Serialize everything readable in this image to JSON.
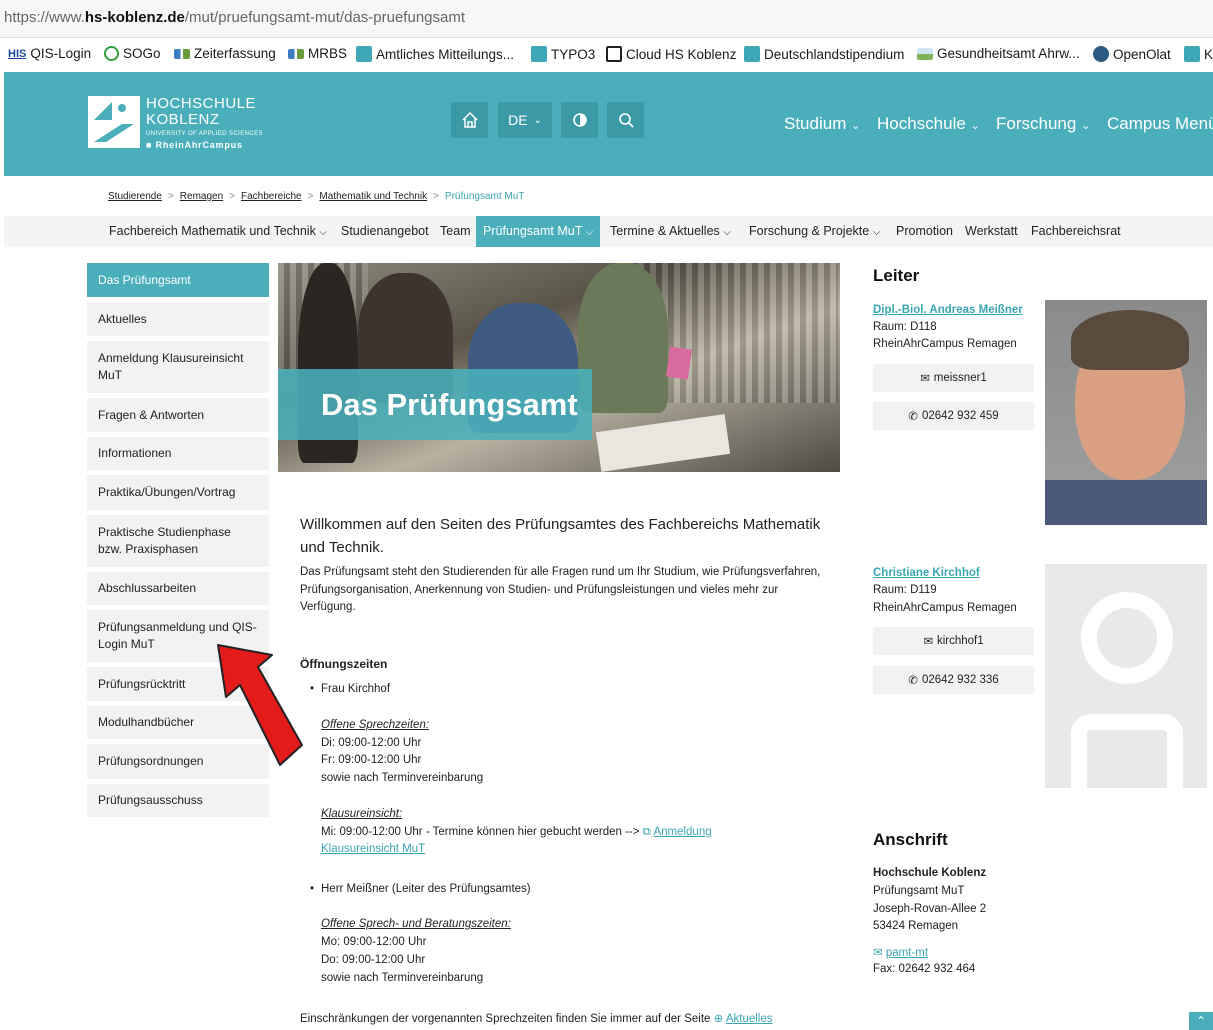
{
  "browser": {
    "url_prefix": "https://www.",
    "url_host": "hs-koblenz.de",
    "url_path": "/mut/pruefungsamt-mut/das-pruefungsamt"
  },
  "bookmarks": [
    {
      "label": "QIS-Login",
      "icon": "his-icon"
    },
    {
      "label": "SOGo",
      "icon": "sogo-icon"
    },
    {
      "label": "Zeiterfassung",
      "icon": "bar-icon"
    },
    {
      "label": "MRBS",
      "icon": "bar-icon"
    },
    {
      "label": "Amtliches Mitteilungs...",
      "icon": "hs-icon"
    },
    {
      "label": "TYPO3",
      "icon": "hs-icon"
    },
    {
      "label": "Cloud HS Koblenz",
      "icon": "folder-icon"
    },
    {
      "label": "Deutschlandstipendium",
      "icon": "hs-icon"
    },
    {
      "label": "Gesundheitsamt Ahrw...",
      "icon": "image-icon"
    },
    {
      "label": "OpenOlat",
      "icon": "openolat-icon"
    },
    {
      "label": "K",
      "icon": "hs-icon"
    }
  ],
  "logo": {
    "line1": "HOCHSCHULE",
    "line2": "KOBLENZ",
    "line3": "UNIVERSITY OF APPLIED SCIENCES",
    "line4": "RheinAhrCampus"
  },
  "header": {
    "lang": "DE",
    "nav": [
      "Studium",
      "Hochschule",
      "Forschung",
      "Campus Menü"
    ]
  },
  "breadcrumb": [
    "Studierende",
    "Remagen",
    "Fachbereiche",
    "Mathematik und Technik",
    "Prüfungsamt MuT"
  ],
  "subnav": [
    "Fachbereich Mathematik und Technik",
    "Studienangebot",
    "Team",
    "Prüfungsamt MuT",
    "Termine & Aktuelles",
    "Forschung & Projekte",
    "Promotion",
    "Werkstatt",
    "Fachbereichsrat"
  ],
  "sidebar": [
    "Das Prüfungsamt",
    "Aktuelles",
    "Anmeldung Klausureinsicht MuT",
    "Fragen & Antworten",
    "Informationen",
    "Praktika/Übungen/Vortrag",
    "Praktische Studienphase bzw. Praxisphasen",
    "Abschlussarbeiten",
    "Prüfungsanmeldung und QIS-Login MuT",
    "Prüfungsrücktritt",
    "Modulhandbücher",
    "Prüfungsordnungen",
    "Prüfungsausschuss"
  ],
  "hero": {
    "title": "Das Prüfungsamt"
  },
  "content": {
    "intro": "Willkommen auf den Seiten des Prüfungsamtes des Fachbereichs Mathematik und Technik.",
    "para": "Das Prüfungsamt steht den Studierenden für alle Fragen rund um Ihr Studium, wie Prüfungsverfahren, Prüfungsorganisation, Anerkennung von Studien- und Prüfungsleistungen und vieles mehr zur Verfügung.",
    "oeffnungszeiten": "Öffnungszeiten",
    "kirchhof": "Frau Kirchhof",
    "sprechzeiten_label": "Offene Sprechzeiten:",
    "k_line1": "Di: 09:00-12:00 Uhr",
    "k_line2": "Fr: 09:00-12:00 Uhr",
    "k_line3": "sowie nach Terminvereinbarung",
    "klausur_label": "Klausureinsicht:",
    "klausur_text": "Mi: 09:00-12:00 Uhr - Termine können hier gebucht werden -->",
    "klausur_link1": "Anmeldung",
    "klausur_link2": "Klausureinsicht MuT",
    "meissner": "Herr Meißner (Leiter des Prüfungsamtes)",
    "beratung_label": "Offene Sprech- und Beratungszeiten:",
    "m_line1": "Mo: 09:00-12:00 Uhr",
    "m_line2": "Do: 09:00-12:00 Uhr",
    "m_line3": "sowie nach Terminvereinbarung",
    "footer_text": "Einschränkungen der vorgenannten Sprechzeiten finden Sie immer auf der Seite",
    "footer_link": "Aktuelles"
  },
  "leiter": {
    "heading": "Leiter",
    "name": "Dipl.-Biol. Andreas Meißner",
    "raum": "Raum: D118",
    "campus": "RheinAhrCampus Remagen",
    "email": "meissner1",
    "phone": "02642 932 459"
  },
  "person2": {
    "name": "Christiane Kirchhof",
    "raum": "Raum: D119",
    "campus": "RheinAhrCampus Remagen",
    "email": "kirchhof1",
    "phone": "02642 932 336"
  },
  "anschrift": {
    "heading": "Anschrift",
    "org": "Hochschule Koblenz",
    "dept": "Prüfungsamt MuT",
    "street": "Joseph-Rovan-Allee 2",
    "city": "53424 Remagen",
    "email": "pamt-mt",
    "fax": "Fax: 02642 932 464"
  },
  "colors": {
    "accent": "#4aafbb",
    "arrow": "#e31b1b"
  }
}
